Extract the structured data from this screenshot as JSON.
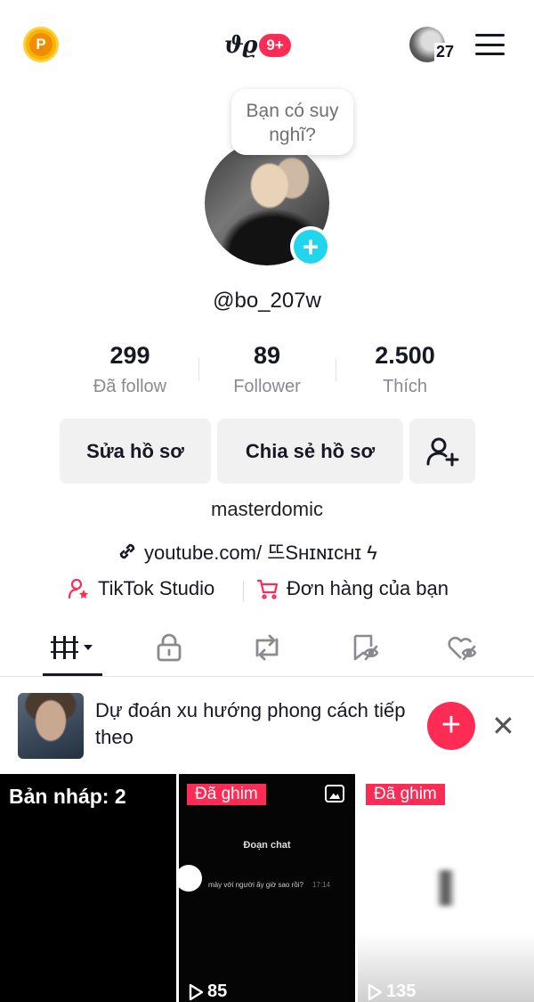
{
  "header": {
    "coin_label": "P",
    "notifications_badge": "9+",
    "account_count": "27"
  },
  "profile": {
    "bubble_text": "Bạn có suy nghĩ?",
    "username": "@bo_207w",
    "stats": [
      {
        "value": "299",
        "label": "Đã follow"
      },
      {
        "value": "89",
        "label": "Follower"
      },
      {
        "value": "2.500",
        "label": "Thích"
      }
    ],
    "edit_button": "Sửa hồ sơ",
    "share_button": "Chia sẻ hồ sơ",
    "bio": "masterdomic",
    "link": "youtube.com/ 뜨Sʜɪɴɪᴄʜɪ ϟ",
    "studio_label": "TikTok Studio",
    "orders_label": "Đơn hàng của bạn"
  },
  "tabs": [
    "videos-tab",
    "private-tab",
    "repost-tab",
    "favorites-tab",
    "liked-tab"
  ],
  "suggestion": {
    "text": "Dự đoán xu hướng phong cách tiếp theo"
  },
  "grid": {
    "draft_label": "Bản nháp: 2",
    "items": [
      {
        "pinned": "Đã ghim",
        "chat_title": "Đoạn chat",
        "chat_msg": "mày với người ấy giờ sao rồi?",
        "chat_time": "17:14",
        "views": "85"
      },
      {
        "pinned": "Đã ghim",
        "views": "135"
      }
    ]
  },
  "colors": {
    "accent": "#fe2c55",
    "cyan": "#20d5ec"
  }
}
